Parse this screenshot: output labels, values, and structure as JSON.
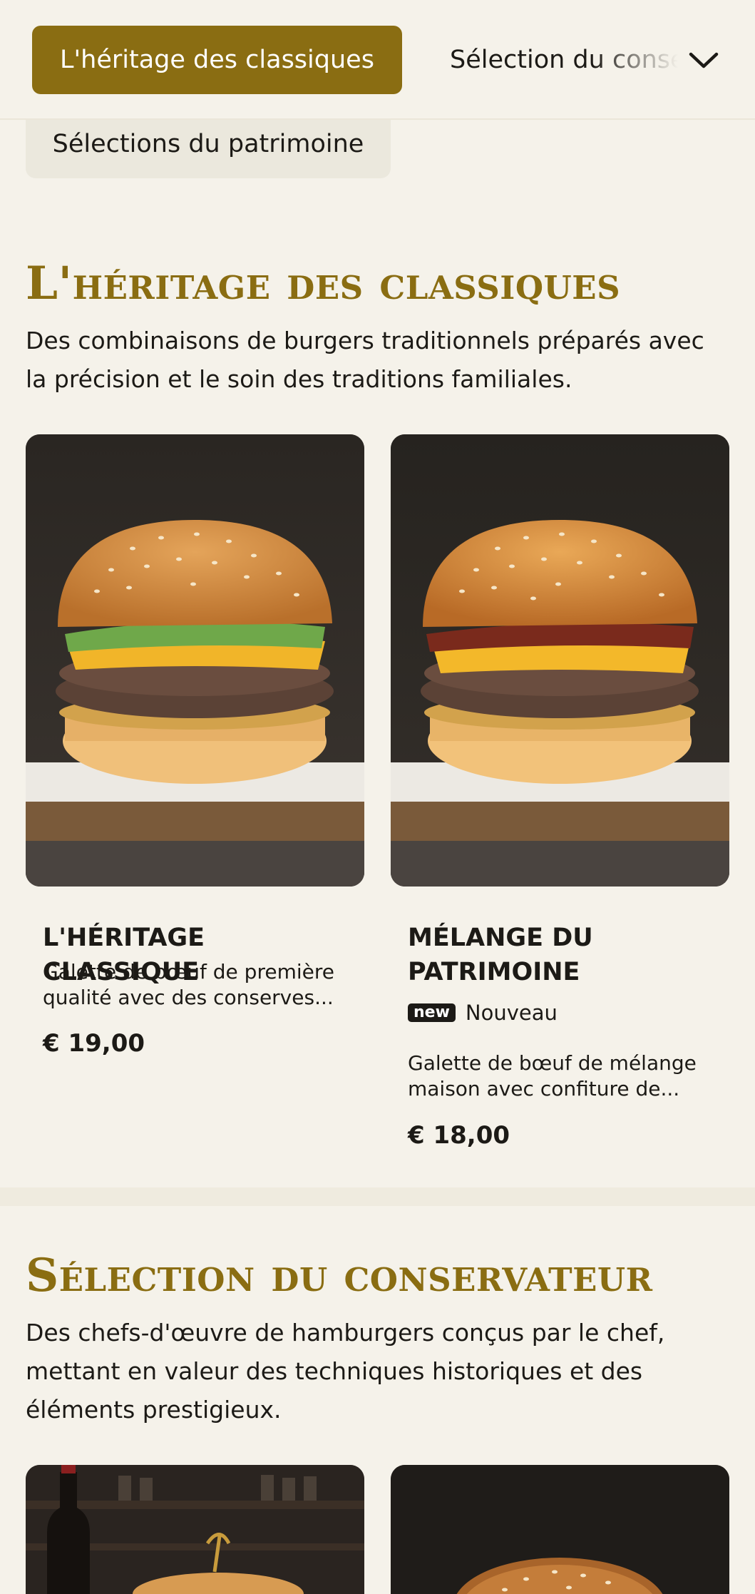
{
  "nav": {
    "active_tab": "L'héritage des classiques",
    "next_tab": "Sélection du conservateur",
    "chevron_icon": "chevron-down-icon",
    "partial_tab": "Sélections du patrimoine"
  },
  "sections": [
    {
      "title": "L'héritage des classiques",
      "description": "Des combinaisons de burgers traditionnels préparés avec la précision et le soin des traditions familiales.",
      "items": [
        {
          "name": "L'HÉRITAGE CLASSIQUE",
          "description": "Galette de bœuf de première qualité avec des conserves...",
          "price": "€ 19,00",
          "image": "burger-lettuce-jam-photo"
        },
        {
          "name": "MÉLANGE DU PATRIMOINE",
          "badge": "new",
          "badge_label": "Nouveau",
          "description": "Galette de bœuf de mélange maison avec confiture de...",
          "price": "€ 18,00",
          "image": "burger-bacon-cheese-photo"
        }
      ]
    },
    {
      "title": "Sélection du conservateur",
      "description": "Des chefs-d'œuvre de hamburgers conçus par le chef, mettant en valeur des techniques historiques et des éléments prestigieux.",
      "items": [
        {
          "image": "burger-wine-bottle-photo"
        },
        {
          "image": "burger-dark-background-photo"
        }
      ]
    }
  ],
  "colors": {
    "accent": "#8a6d12",
    "background": "#f5f2ea",
    "text": "#1c1a16"
  }
}
